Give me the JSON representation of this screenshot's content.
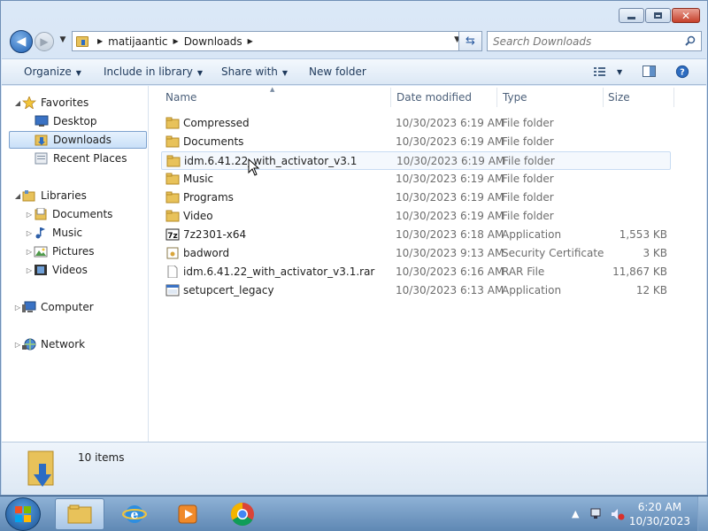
{
  "address": {
    "crumbs": [
      "matijaantic",
      "Downloads"
    ],
    "search_placeholder": "Search Downloads"
  },
  "toolbar": {
    "organize": "Organize",
    "include_in_library": "Include in library",
    "share_with": "Share with",
    "new_folder": "New folder"
  },
  "navpane": {
    "favorites": "Favorites",
    "desktop": "Desktop",
    "downloads": "Downloads",
    "recent_places": "Recent Places",
    "libraries": "Libraries",
    "documents": "Documents",
    "music": "Music",
    "pictures": "Pictures",
    "videos": "Videos",
    "computer": "Computer",
    "network": "Network"
  },
  "columns": {
    "name": "Name",
    "date": "Date modified",
    "type": "Type",
    "size": "Size"
  },
  "files": [
    {
      "name": "Compressed",
      "date": "10/30/2023 6:19 AM",
      "type": "File folder",
      "size": "",
      "icon": "folder-icon"
    },
    {
      "name": "Documents",
      "date": "10/30/2023 6:19 AM",
      "type": "File folder",
      "size": "",
      "icon": "folder-icon"
    },
    {
      "name": "idm.6.41.22_with_activator_v3.1",
      "date": "10/30/2023 6:19 AM",
      "type": "File folder",
      "size": "",
      "icon": "folder-icon"
    },
    {
      "name": "Music",
      "date": "10/30/2023 6:19 AM",
      "type": "File folder",
      "size": "",
      "icon": "folder-icon"
    },
    {
      "name": "Programs",
      "date": "10/30/2023 6:19 AM",
      "type": "File folder",
      "size": "",
      "icon": "folder-icon"
    },
    {
      "name": "Video",
      "date": "10/30/2023 6:19 AM",
      "type": "File folder",
      "size": "",
      "icon": "folder-icon"
    },
    {
      "name": "7z2301-x64",
      "date": "10/30/2023 6:18 AM",
      "type": "Application",
      "size": "1,553 KB",
      "icon": "7zip-icon"
    },
    {
      "name": "badword",
      "date": "10/30/2023 9:13 AM",
      "type": "Security Certificate",
      "size": "3 KB",
      "icon": "certificate-icon"
    },
    {
      "name": "idm.6.41.22_with_activator_v3.1.rar",
      "date": "10/30/2023 6:16 AM",
      "type": "RAR File",
      "size": "11,867 KB",
      "icon": "file-icon"
    },
    {
      "name": "setupcert_legacy",
      "date": "10/30/2023 6:13 AM",
      "type": "Application",
      "size": "12 KB",
      "icon": "application-icon"
    }
  ],
  "status": {
    "item_count": "10 items"
  },
  "clock": {
    "time": "6:20 AM",
    "date": "10/30/2023"
  },
  "colors": {
    "folder": "#e8c25a",
    "selection": "#c9e0f8",
    "taskbar": "#6f97c2"
  }
}
